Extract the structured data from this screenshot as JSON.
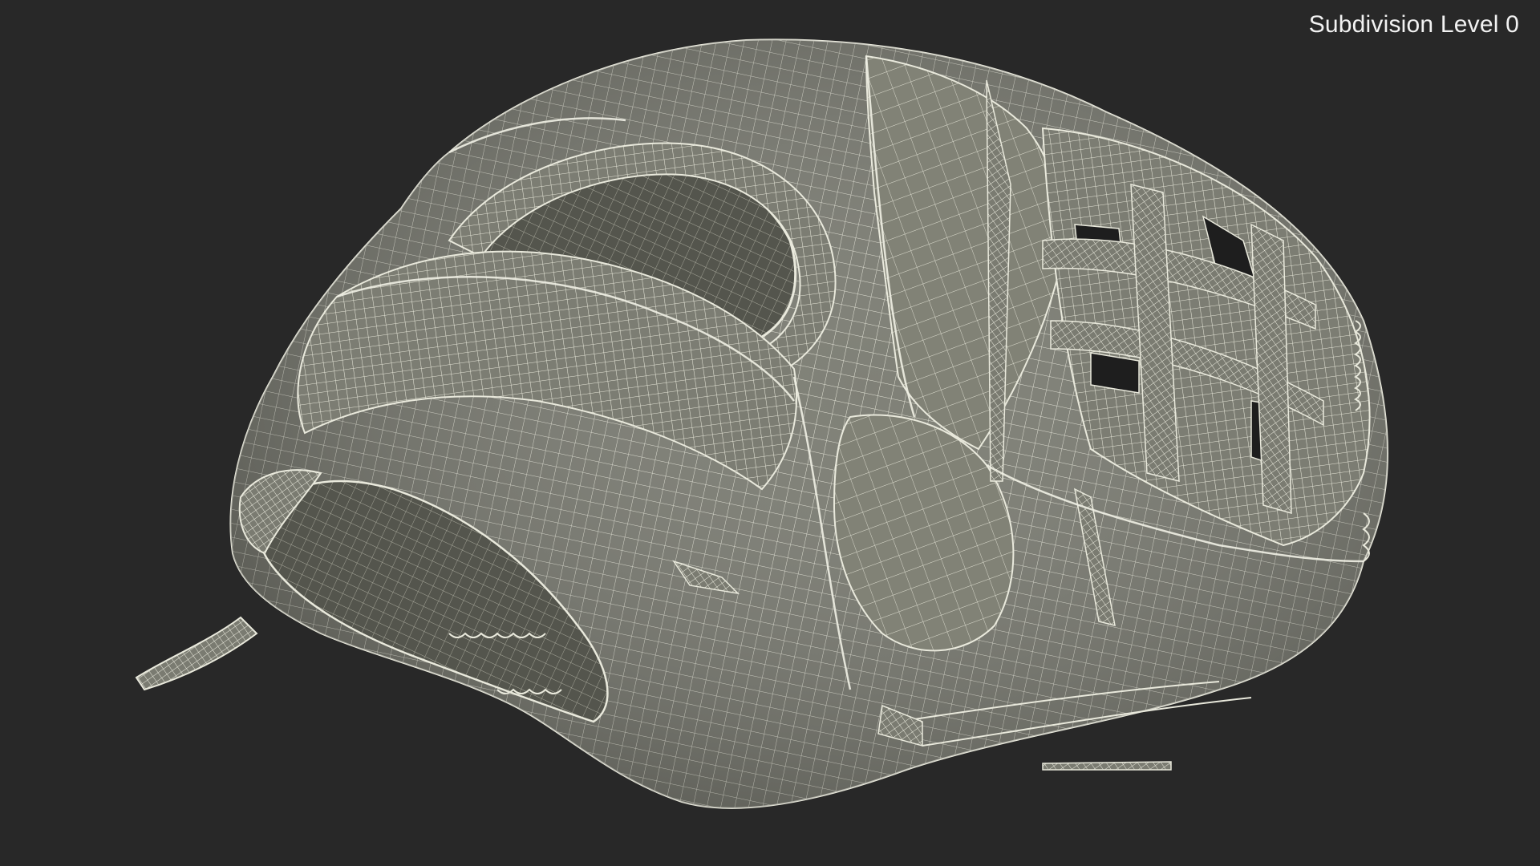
{
  "viewport": {
    "overlay_label": "Subdivision Level 0",
    "background_color": "#282828",
    "model_surface_color": "#7c7d73",
    "wireframe_color": "#e9e9dc",
    "render_mode": "wireframe-on-shaded",
    "model_subject": "baseball-glove"
  }
}
